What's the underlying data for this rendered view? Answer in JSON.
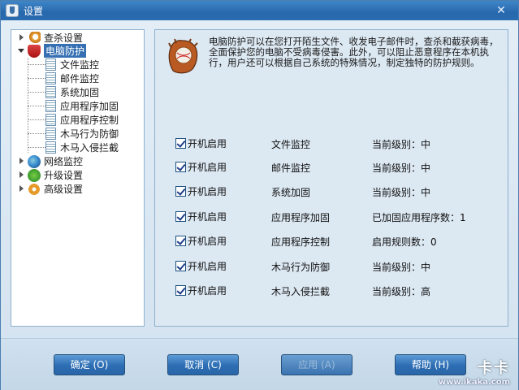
{
  "window": {
    "title": "设置",
    "close_symbol": "✕"
  },
  "tree": {
    "items": [
      {
        "label": "查杀设置",
        "icon": "scan-icon"
      },
      {
        "label": "电脑防护",
        "icon": "shield-icon",
        "selected": true,
        "children": [
          "文件监控",
          "邮件监控",
          "系统加固",
          "应用程序加固",
          "应用程序控制",
          "木马行为防御",
          "木马入侵拦截"
        ]
      },
      {
        "label": "网络监控",
        "icon": "globe-icon"
      },
      {
        "label": "升级设置",
        "icon": "update-icon"
      },
      {
        "label": "高级设置",
        "icon": "gear-icon"
      }
    ]
  },
  "content": {
    "description": "电脑防护可以在您打开陌生文件、收发电子邮件时，查杀和截获病毒，全面保护您的电脑不受病毒侵害。此外，可以阻止恶意程序在本机执行，用户还可以根据自己系统的特殊情况，制定独特的防护规则。",
    "rows": [
      {
        "checkbox_label": "开机启用",
        "module": "文件监控",
        "level": "当前级别：中"
      },
      {
        "checkbox_label": "开机启用",
        "module": "邮件监控",
        "level": "当前级别：中"
      },
      {
        "checkbox_label": "开机启用",
        "module": "系统加固",
        "level": "当前级别：中"
      },
      {
        "checkbox_label": "开机启用",
        "module": "应用程序加固",
        "level": "已加固应用程序数：1"
      },
      {
        "checkbox_label": "开机启用",
        "module": "应用程序控制",
        "level": "启用规则数：0"
      },
      {
        "checkbox_label": "开机启用",
        "module": "木马行为防御",
        "level": "当前级别：中"
      },
      {
        "checkbox_label": "开机启用",
        "module": "木马入侵拦截",
        "level": "当前级别：高"
      }
    ]
  },
  "buttons": {
    "ok": "确定 (O)",
    "cancel": "取消 (C)",
    "apply": "应用 (A)",
    "help": "帮助 (H)"
  },
  "watermark": {
    "logo": "卡卡",
    "url": "www.ikaka.com"
  }
}
